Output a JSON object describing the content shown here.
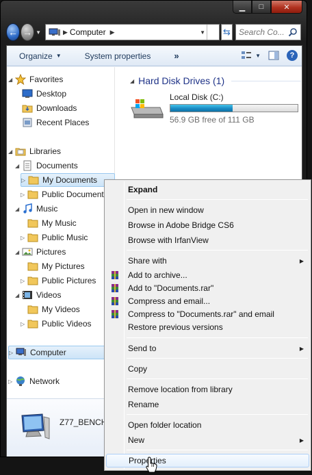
{
  "window": {
    "caption_buttons": [
      "minimize",
      "maximize",
      "close"
    ],
    "address_path": "Computer",
    "search_placeholder": "Search Co...",
    "toolbar": {
      "organize": "Organize",
      "system_properties": "System properties",
      "more": "»"
    }
  },
  "nav": {
    "favorites": "Favorites",
    "desktop": "Desktop",
    "downloads": "Downloads",
    "recent_places": "Recent Places",
    "libraries": "Libraries",
    "documents": "Documents",
    "my_documents": "My Documents",
    "public_documents": "Public Documents",
    "music": "Music",
    "my_music": "My Music",
    "public_music": "Public Music",
    "pictures": "Pictures",
    "my_pictures": "My Pictures",
    "public_pictures": "Public Pictures",
    "videos": "Videos",
    "my_videos": "My Videos",
    "public_videos": "Public Videos",
    "computer": "Computer",
    "network": "Network"
  },
  "content": {
    "group_title": "Hard Disk Drives (1)",
    "drive_name": "Local Disk (C:)",
    "drive_free": "56.9 GB free of 111 GB",
    "drive_used_fraction": 0.49
  },
  "details": {
    "computer_name": "Z77_BENCH"
  },
  "context_menu": {
    "expand": "Expand",
    "open_new_window": "Open in new window",
    "browse_bridge": "Browse in Adobe Bridge CS6",
    "browse_irfanview": "Browse with IrfanView",
    "share_with": "Share with",
    "add_archive": "Add to archive...",
    "add_documents_rar": "Add to \"Documents.rar\"",
    "compress_email": "Compress and email...",
    "compress_rar_email": "Compress to \"Documents.rar\" and email",
    "restore_previous": "Restore previous versions",
    "send_to": "Send to",
    "copy": "Copy",
    "remove_location": "Remove location from library",
    "rename": "Rename",
    "open_folder_location": "Open folder location",
    "new": "New",
    "properties": "Properties"
  }
}
